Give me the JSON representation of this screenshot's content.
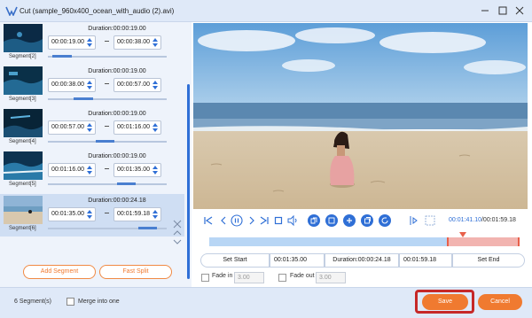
{
  "window": {
    "title": "Cut (sample_960x400_ocean_with_audio (2).avi)"
  },
  "segments": [
    {
      "label": "Segment[2]",
      "duration": "Duration:00:00:19.00",
      "start": "00:00:19.00",
      "end": "00:00:38.00",
      "selected": false,
      "progress": 0.12
    },
    {
      "label": "Segment[3]",
      "duration": "Duration:00:00:19.00",
      "start": "00:00:38.00",
      "end": "00:00:57.00",
      "selected": false,
      "progress": 0.3
    },
    {
      "label": "Segment[4]",
      "duration": "Duration:00:00:19.00",
      "start": "00:00:57.00",
      "end": "00:01:16.00",
      "selected": false,
      "progress": 0.48
    },
    {
      "label": "Segment[5]",
      "duration": "Duration:00:00:19.00",
      "start": "00:01:16.00",
      "end": "00:01:35.00",
      "selected": false,
      "progress": 0.66
    },
    {
      "label": "Segment[6]",
      "duration": "Duration:00:00:24.18",
      "start": "00:01:35.00",
      "end": "00:01:59.18",
      "selected": true,
      "progress": 0.84
    }
  ],
  "buttons": {
    "add_segment": "Add Segment",
    "fast_split": "Fast Split",
    "set_start": "Set Start",
    "set_end": "Set End",
    "save": "Save",
    "cancel": "Cancel"
  },
  "playback": {
    "current_time": "00:01:41.10",
    "total_time": "/00:01:59.18"
  },
  "trim": {
    "start": "00:01:35.00",
    "duration": "Duration:00:00:24.18",
    "end": "00:01:59.18"
  },
  "fade": {
    "fade_in_label": "Fade in",
    "fade_in_value": "3.00",
    "fade_out_label": "Fade out",
    "fade_out_value": "3.00"
  },
  "footer": {
    "segment_count": "6 Segment(s)",
    "merge_label": "Merge into one"
  },
  "colors": {
    "accent": "#f07a30",
    "blue": "#2f6fd6",
    "highlight": "#c62828"
  }
}
